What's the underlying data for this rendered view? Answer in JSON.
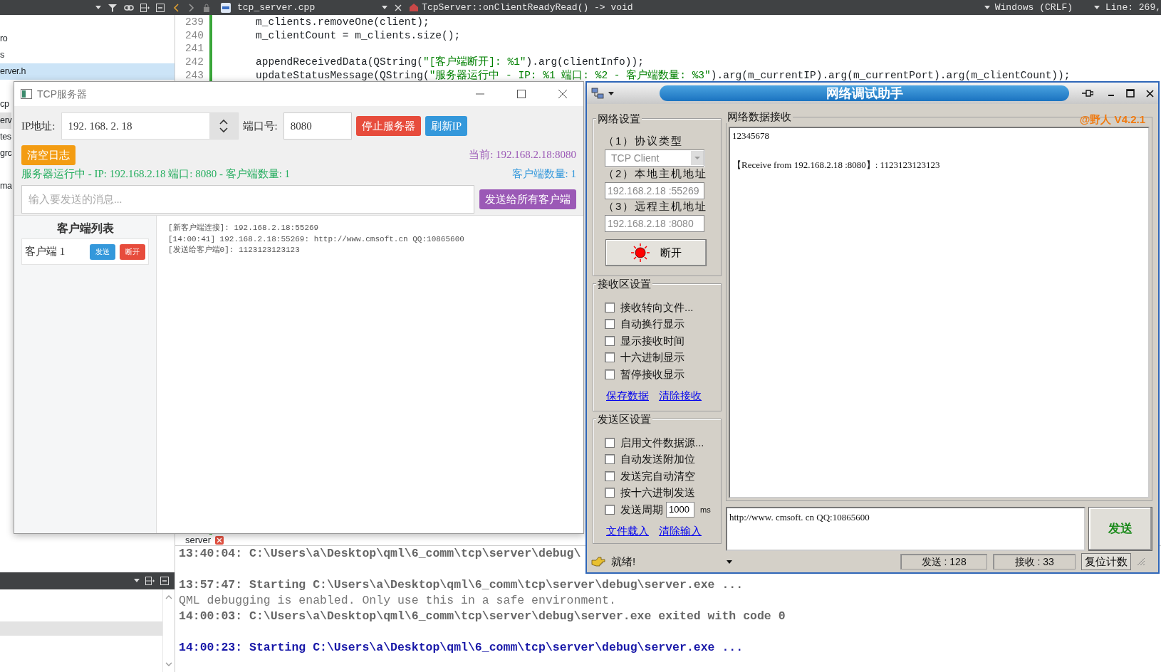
{
  "ide": {
    "toolbar": {
      "file_tab": "tcp_server.cpp",
      "symbol": "TcpServer::onClientReadyRead() -> void",
      "line_ending": "Windows (CRLF)",
      "cursor": "Line: 269,"
    },
    "file_tree": [
      {
        "label": "ro",
        "selected": false,
        "highlighted": false,
        "gap_before": false
      },
      {
        "label": "s",
        "selected": false,
        "highlighted": false,
        "gap_before": false
      },
      {
        "label": "erver.h",
        "selected": true,
        "highlighted": false,
        "gap_before": false
      },
      {
        "label": "cp",
        "selected": false,
        "highlighted": false,
        "gap_before": true
      },
      {
        "label": "erv",
        "selected": false,
        "highlighted": true,
        "gap_before": false
      },
      {
        "label": "tes",
        "selected": false,
        "highlighted": false,
        "gap_before": false
      },
      {
        "label": "grc",
        "selected": false,
        "highlighted": false,
        "gap_before": false
      },
      {
        "label": "ma",
        "selected": false,
        "highlighted": false,
        "gap_before": true
      }
    ],
    "code_lines": [
      {
        "number": "239",
        "text": "    m_clients.removeOne(client);"
      },
      {
        "number": "240",
        "text": "    m_clientCount = m_clients.size();"
      },
      {
        "number": "241"
      },
      {
        "number": "242",
        "text": "    appendReceivedData(QString(\"[客户端断开]: %1\").arg(clientInfo));"
      },
      {
        "number": "243",
        "text": "    updateStatusMessage(QString(\"服务器运行中 - IP: %1 端口: %2 - 客户端数量: %3\").arg(m_currentIP).arg(m_currentPort).arg(m_clientCount));"
      }
    ],
    "output_tab": "server",
    "output_lines": [
      {
        "kind": "info",
        "spaced": false,
        "text": "13:40:04: C:\\Users\\a\\Desktop\\qml\\6_comm\\tcp\\server\\debug\\"
      },
      {
        "kind": "info",
        "spaced": true,
        "text": "13:57:47: Starting C:\\Users\\a\\Desktop\\qml\\6_comm\\tcp\\server\\debug\\server.exe ..."
      },
      {
        "kind": "debug",
        "spaced": false,
        "text": "QML debugging is enabled. Only use this in a safe environment."
      },
      {
        "kind": "info",
        "spaced": false,
        "text": "14:00:03: C:\\Users\\a\\Desktop\\qml\\6_comm\\tcp\\server\\debug\\server.exe exited with code 0"
      },
      {
        "kind": "start",
        "spaced": true,
        "text": "14:00:23: Starting C:\\Users\\a\\Desktop\\qml\\6_comm\\tcp\\server\\debug\\server.exe ..."
      }
    ]
  },
  "server_window": {
    "title": "TCP服务器",
    "ip_label": "IP地址:",
    "ip_value": "192. 168. 2. 18",
    "port_label": "端口号:",
    "port_value": "8080",
    "stop_button": "停止服务器",
    "refresh_button": "刷新IP",
    "clear_button": "清空日志",
    "current": "当前: 192.168.2.18:8080",
    "status": "服务器运行中 - IP: 192.168.2.18 端口: 8080 - 客户端数量: 1",
    "client_count": "客户端数量: 1",
    "message": {
      "placeholder": "输入要发送的消息..."
    },
    "broadcast_button": "发送给所有客户端",
    "client_list": {
      "title": "客户端列表",
      "clients": [
        {
          "name": "客户端 1",
          "send": "发送",
          "disconnect": "断开"
        }
      ]
    },
    "log": [
      "[新客户端连接]: 192.168.2.18:55269",
      "[14:00:41] 192.168.2.18:55269: http://www.cmsoft.cn QQ:10865600",
      "[发送给客户端0]: 1123123123123"
    ]
  },
  "assistant_window": {
    "title": "网络调试助手",
    "version": "@野人 V4.2.1",
    "network": {
      "title": "网络设置",
      "protocol_label": "（1）协议类型",
      "protocol": {
        "value": "TCP Client",
        "disabled": true
      },
      "local_label": "（2）本地主机地址",
      "local": {
        "value": "192.168.2.18 :55269",
        "disabled": true
      },
      "remote_label": "（3）远程主机地址",
      "remote": {
        "value": "192.168.2.18 :8080",
        "disabled": true
      },
      "connect_button": {
        "label": "断开",
        "connected": true
      }
    },
    "receive_settings": {
      "title": "接收区设置",
      "options": [
        {
          "label": "接收转向文件...",
          "checked": false
        },
        {
          "label": "自动换行显示",
          "checked": false
        },
        {
          "label": "显示接收时间",
          "checked": false
        },
        {
          "label": "十六进制显示",
          "checked": false
        },
        {
          "label": "暂停接收显示",
          "checked": false
        }
      ],
      "links": [
        "保存数据",
        "清除接收"
      ]
    },
    "send_settings": {
      "title": "发送区设置",
      "options": [
        {
          "label": "启用文件数据源...",
          "checked": false
        },
        {
          "label": "自动发送附加位",
          "checked": false
        },
        {
          "label": "发送完自动清空",
          "checked": false
        },
        {
          "label": "按十六进制发送",
          "checked": false
        }
      ],
      "period": {
        "label": "发送周期",
        "checked": false,
        "value": "1000",
        "unit": "ms"
      },
      "links": [
        "文件载入",
        "清除输入"
      ]
    },
    "receive": {
      "title": "网络数据接收",
      "lines": [
        {
          "text": "12345678",
          "spaced": false
        },
        {
          "text": "【Receive from 192.168.2.18 :8080】: 1123123123123",
          "spaced": true
        }
      ]
    },
    "send": {
      "value": "http://www. cmsoft. cn QQ:10865600",
      "button": "发送"
    },
    "status_bar": {
      "message": "就绪!",
      "sent": "发送 : 128",
      "received": "接收 : 33",
      "reset_button": "复位计数"
    }
  }
}
